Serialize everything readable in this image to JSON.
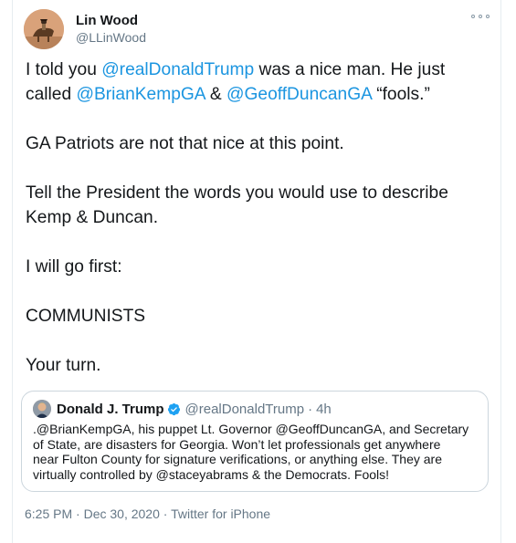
{
  "author": {
    "display_name": "Lin Wood",
    "handle": "@LLinWood",
    "avatar_icon": "avatar-horse-rider"
  },
  "more_icon": "ellipsis-icon",
  "tweet": {
    "line1_prefix": "I told you ",
    "mention_trump": "@realDonaldTrump",
    "line1_suffix": " was a nice man. He just",
    "line2_prefix": "called ",
    "mention_kemp": "@BrianKempGA",
    "amp": " & ",
    "mention_duncan": "@GeoffDuncanGA",
    "line2_suffix": " “fools.”",
    "para2": "GA Patriots are not that nice at this point.",
    "para3_line1": "Tell the President the words you would use to describe",
    "para3_line2": "Kemp & Duncan.",
    "para4": "I will go first:",
    "para5": "COMMUNISTS",
    "para6": "Your turn."
  },
  "quoted": {
    "display_name": "Donald J. Trump",
    "handle": "@realDonaldTrump",
    "dot": "·",
    "time": "4h",
    "verified_icon": "verified-badge-icon",
    "line1": ".@BrianKempGA, his puppet Lt. Governor @GeoffDuncanGA, and Secretary",
    "line2": "of State, are disasters for Georgia. Won’t let professionals get anywhere",
    "line3": "near Fulton County for signature verifications, or anything else. They are",
    "line4": "virtually controlled by @staceyabrams & the Democrats. Fools!"
  },
  "meta": {
    "time": "6:25 PM",
    "sep1": " · ",
    "date": "Dec 30, 2020",
    "sep2": " · ",
    "source": "Twitter for iPhone"
  },
  "colors": {
    "link": "#1b95e0",
    "secondary_text": "#657786",
    "border": "#ccd6dd",
    "verified": "#1da1f2"
  }
}
